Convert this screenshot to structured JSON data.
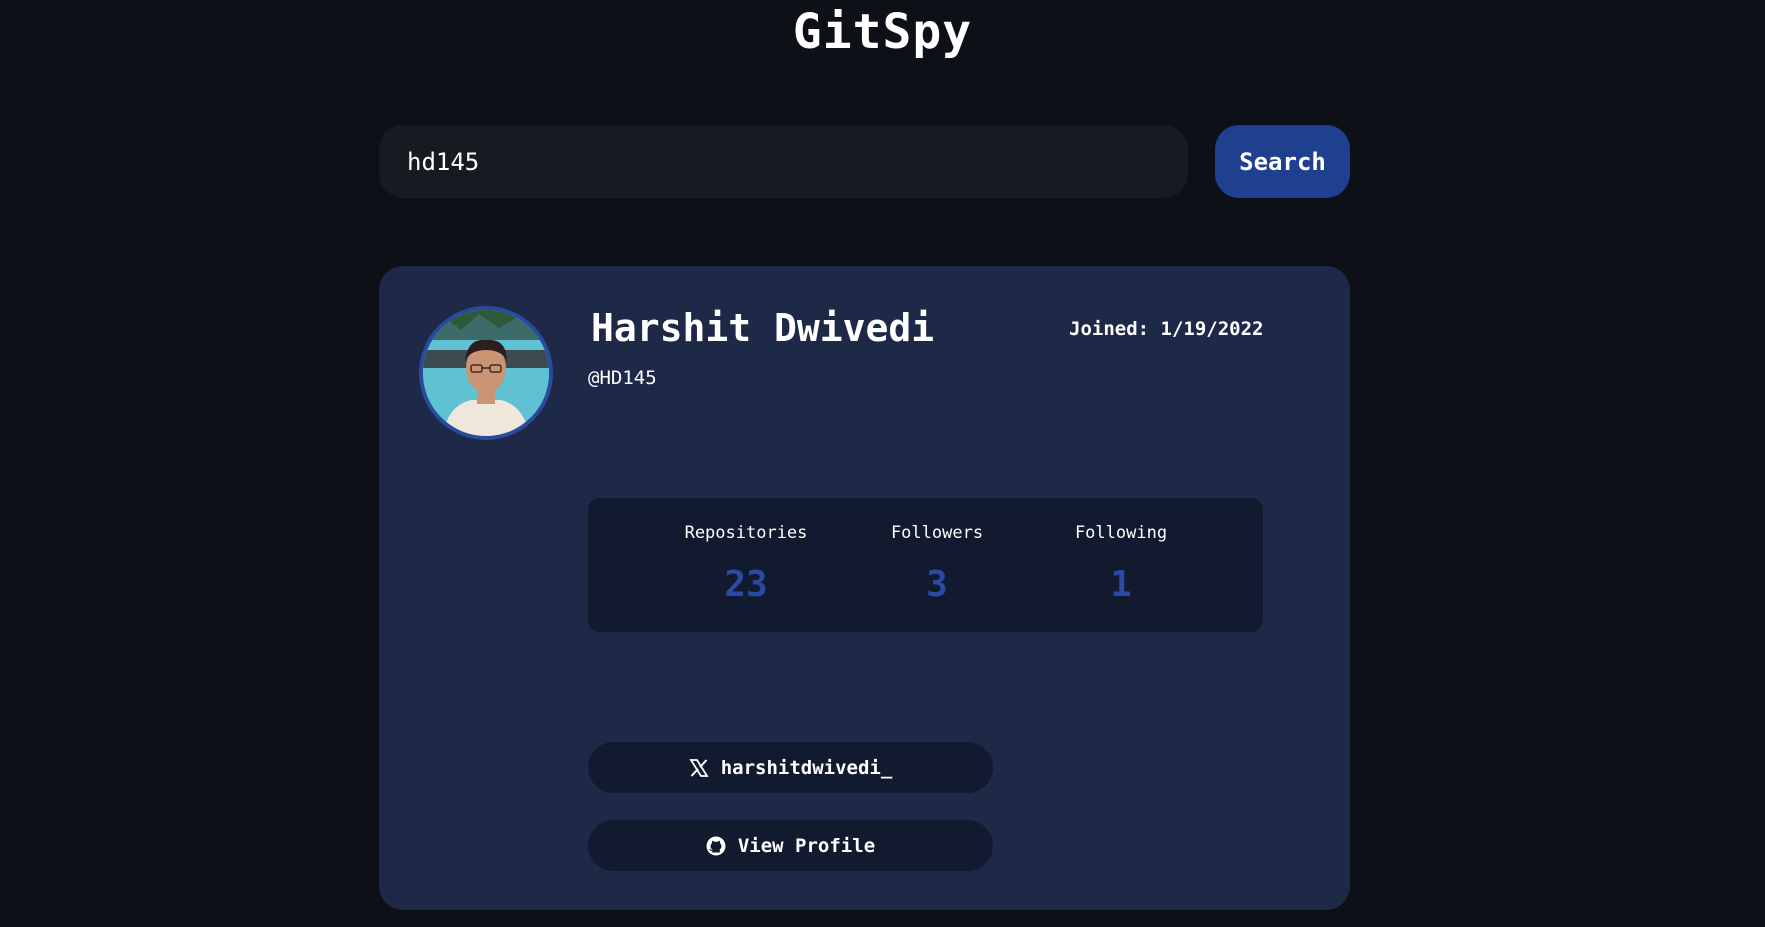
{
  "app": {
    "title": "GitSpy"
  },
  "search": {
    "value": "hd145",
    "button_label": "Search"
  },
  "profile": {
    "name": "Harshit Dwivedi",
    "handle": "@HD145",
    "joined": "Joined: 1/19/2022",
    "avatar_icon": "profile-photo",
    "stats": [
      {
        "label": "Repositories",
        "value": "23"
      },
      {
        "label": "Followers",
        "value": "3"
      },
      {
        "label": "Following",
        "value": "1"
      }
    ],
    "links": {
      "twitter": {
        "icon": "x-logo-icon",
        "label": "harshitdwivedi_"
      },
      "github": {
        "icon": "github-icon",
        "label": "View Profile"
      }
    }
  },
  "colors": {
    "background": "#0d1117",
    "card": "#1e2948",
    "panel": "#111a2e",
    "accent": "#1f3f8f",
    "stat_value": "#2b4aa4"
  }
}
